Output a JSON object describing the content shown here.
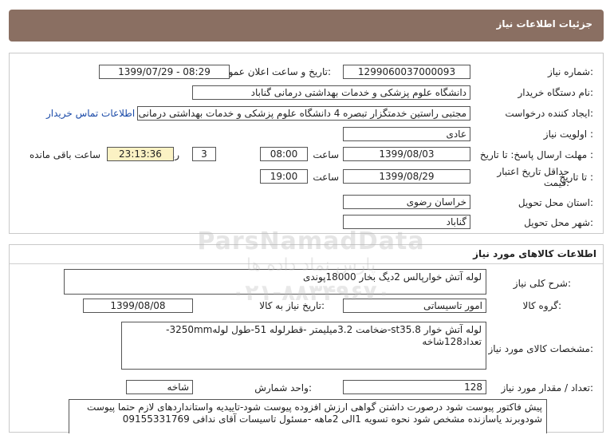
{
  "header": {
    "title": "جزئیات اطلاعات نیاز"
  },
  "info": {
    "need_number_label": "شماره نیاز:",
    "need_number": "1299060037000093",
    "announce_label": "تاریخ و ساعت اعلان عمومی:",
    "announce_value": "1399/07/29 - 08:29",
    "buyer_label": "نام دستگاه خریدار:",
    "buyer_value": "دانشگاه علوم پزشکی و خدمات بهداشتی درمانی گناباد",
    "requester_label": "ایجاد کننده درخواست:",
    "requester_value": "مجتبی راستین خدمتگزار تبصره 4 دانشگاه علوم پزشکی و خدمات بهداشتی درمانی گناباد",
    "contact_link": "اطلاعات تماس خریدار",
    "priority_label": "اولویت نیاز :",
    "priority_value": "عادی",
    "reply_deadline_label": "مهلت ارسال پاسخ:  تا تاریخ :",
    "reply_date": "1399/08/03",
    "time_label": "ساعت",
    "reply_time": "08:00",
    "days_value": "3",
    "days_label": "روز و",
    "remaining_time": "23:13:36",
    "remaining_label": "ساعت باقی مانده",
    "validity_label": "حداقل تاریخ اعتبار قیمت:",
    "validity_until_label": "تا تاریخ :",
    "validity_date": "1399/08/29",
    "validity_time_label": "ساعت",
    "validity_time": "19:00",
    "province_label": "استان محل تحویل:",
    "province_value": "خراسان رضوی",
    "city_label": "شهر محل تحویل:",
    "city_value": "گناباد"
  },
  "goods": {
    "section_title": "اطلاعات کالاهای مورد نیاز",
    "general_desc_label": "شرح کلی نیاز:",
    "general_desc": "لوله آتش خوارپالس 2دیگ بخار 18000پوندی",
    "group_label": "گروه کالا:",
    "group_value": "امور تاسیساتی",
    "need_date_label": "تاریخ نیاز به کالا:",
    "need_date": "1399/08/08",
    "specs_label": "مشخصات کالای مورد نیاز:",
    "specs_value": "لوله آتش خوار st35.8-ضخامت 3.2میلیمتر -قطرلوله 51-طول لوله3250mm-تعداد128شاخه",
    "qty_label": "تعداد / مقدار مورد نیاز:",
    "qty_value": "128",
    "unit_label": "واحد شمارش:",
    "unit_value": "شاخه",
    "notes_value": "پیش فاکتور پیوست شود درصورت داشتن گواهی ارزش افزوده پیوست شود-تاییدیه واستانداردهای لازم حتما پیوست شودوبرند یاسازنده مشخص شود نحوه تسویه 1الی 2ماهه -مسئول تاسیسات آقای ندافی 09155331769"
  },
  "watermark": {
    "line1": "ParsNamadData",
    "line2": "پارس نماد داده ها",
    "line3": "۰۲۱-۸۸۳۴۹۶۷۰"
  }
}
